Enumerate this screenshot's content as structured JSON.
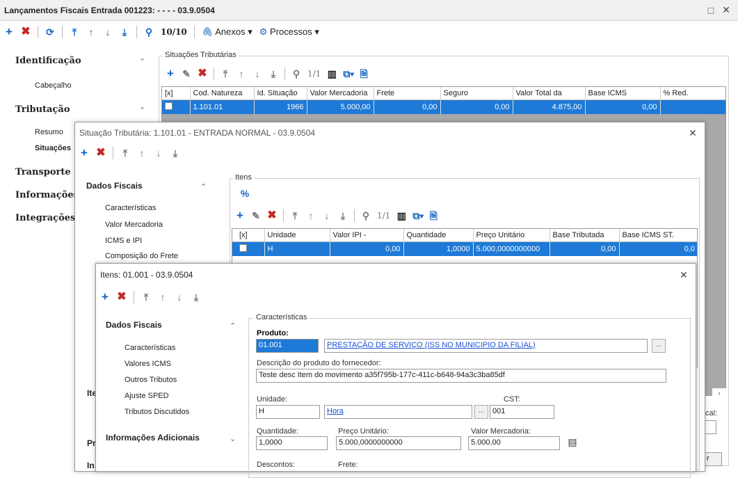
{
  "main": {
    "title": "Lançamentos Fiscais Entrada 001223: - - - - 03.9.0504",
    "counter": "10/10",
    "anexos": "Anexos",
    "processos": "Processos",
    "nav": {
      "identificacao": "Identificação",
      "cabecalho": "Cabeçalho",
      "tributacao": "Tributação",
      "resumo": "Resumo",
      "situacoes": "Situações",
      "transporte": "Transporte",
      "informacoes": "Informações A",
      "integracoes": "Integrações"
    },
    "frag": {
      "it": "Ite",
      "pr": "Pr",
      "in": "In",
      "cal": "cal:",
      "r": "r"
    }
  },
  "situacoes": {
    "group": "Situações Tributárias",
    "pager": "1/1",
    "cols": [
      "[x]",
      "Cod. Natureza",
      "Id. Situação",
      "Valor Mercadoria",
      "Frete",
      "Seguro",
      "Valor Total da",
      "Base ICMS",
      "% Red."
    ],
    "row": [
      "1.101.01",
      "1966",
      "5.000,00",
      "0,00",
      "0,00",
      "4.875,00",
      "0,00"
    ]
  },
  "sitdlg": {
    "title": "Situação Tributária: 1.101.01 - ENTRADA NORMAL - 03.9.0504",
    "section": "Dados Fiscais",
    "items": [
      "Características",
      "Valor Mercadoria",
      "ICMS e IPI",
      "Composição do Frete"
    ],
    "itens_label": "Itens",
    "pager": "1/1",
    "cols": [
      "[x]",
      "Unidade",
      "Valor IPI -",
      "Quantidade",
      "Preço Unitário",
      "Base Tributada",
      "Base ICMS ST."
    ],
    "row": [
      "H",
      "0,00",
      "1,0000",
      "5.000,0000000000",
      "0,00",
      "0,0"
    ]
  },
  "itdlg": {
    "title": "Itens: 01.001 - 03.9.0504",
    "section": "Dados Fiscais",
    "items": [
      "Características",
      "Valores ICMS",
      "Outros Tributos",
      "Ajuste SPED",
      "Tributos Discutidos"
    ],
    "section2": "Informações Adicionais",
    "group": "Características",
    "produto_label": "Produto:",
    "produto_code": "01.001",
    "produto_desc": "PRESTAÇÃO DE SERVIÇO (ISS NO MUNICIPIO DA FILIAL)",
    "desc_label": "Descrição do produto do fornecedor:",
    "desc_value": "Teste desc Item do movimento a35f795b-177c-411c-b648-94a3c3ba85df",
    "unidade_label": "Unidade:",
    "unidade_code": "H",
    "unidade_desc": "Hora",
    "cst_label": "CST:",
    "cst_value": "001",
    "qtd_label": "Quantidade:",
    "qtd_value": "1,0000",
    "preco_label": "Preço Unitário:",
    "preco_value": "5.000,0000000000",
    "valor_label": "Valor Mercadoria:",
    "valor_value": "5.000,00",
    "descontos_label": "Descontos:",
    "frete_label": "Frete:"
  }
}
